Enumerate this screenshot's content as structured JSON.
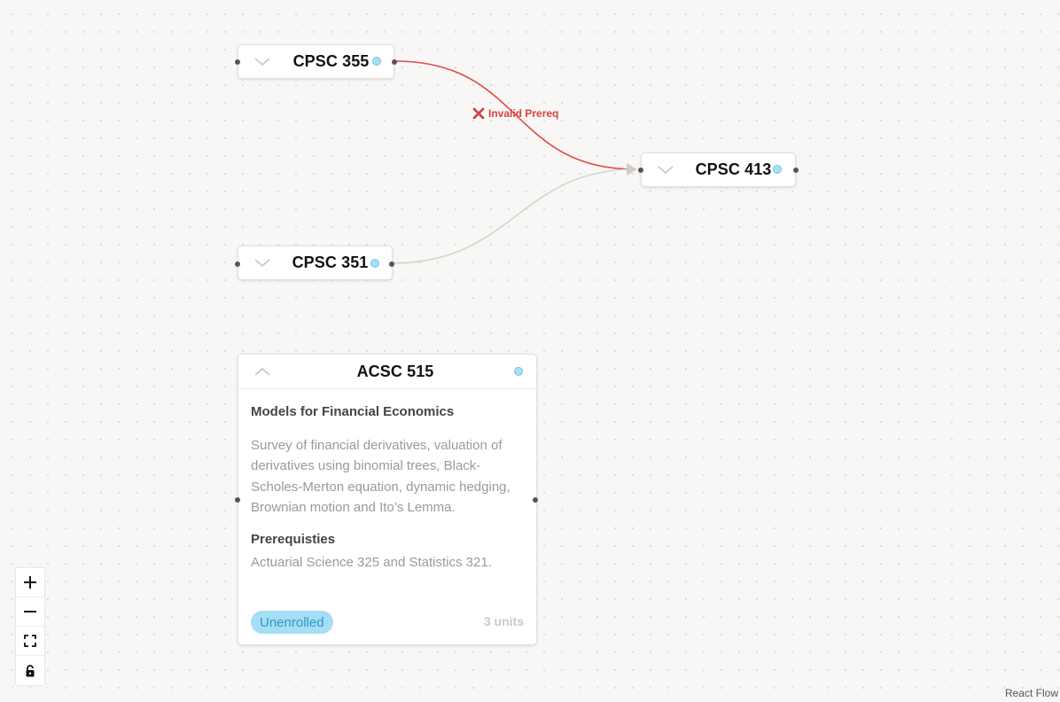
{
  "nodes": {
    "cpsc355": {
      "code": "CPSC 355"
    },
    "cpsc413": {
      "code": "CPSC 413"
    },
    "cpsc351": {
      "code": "CPSC 351"
    },
    "acsc515": {
      "code": "ACSC 515",
      "name": "Models for Financial Economics",
      "description": "Survey of financial derivatives, valuation of derivatives using binomial trees, Black-Scholes-Merton equation, dynamic hedging, Brownian motion and Ito’s Lemma.",
      "prerequisites_heading": "Prerequisties",
      "prerequisites": "Actuarial Science 325 and Statistics 321.",
      "status": "Unenrolled",
      "units": "3 units"
    }
  },
  "edges": {
    "invalid_label": "Invalid Prereq",
    "invalid_color": "#e04848",
    "valid_color": "#d6d4d0"
  },
  "controls": {
    "zoom_in": "plus-icon",
    "zoom_out": "minus-icon",
    "fit_view": "fit-view-icon",
    "lock": "lock-icon"
  },
  "attribution": "React Flow",
  "colors": {
    "status_badge_bg": "#a6def5",
    "status_badge_text": "#2f95c8",
    "node_dot": "#a7dff6"
  }
}
